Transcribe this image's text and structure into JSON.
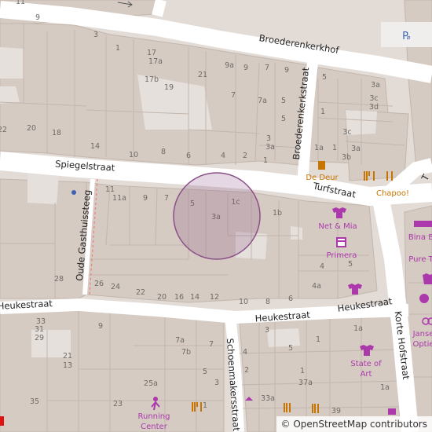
{
  "map": {
    "streets": {
      "broederenkerkhof": "Broederenkerkhof",
      "broederenkerkstraat": "Broederenkerkstraat",
      "spiegelstraat": "Spiegelstraat",
      "turfstraat": "Turfstraat",
      "oude_gasthuissteeg": "Oude Gasthuissteeg",
      "heukestraat_left": "Heukestraat",
      "heukestraat_mid": "Heukestraat",
      "heukestraat_right": "Heukestraat",
      "korte_hofstraat": "Korte Hofstraat",
      "schoenmakersstraat": "Schoenmakersstraat",
      "top_right_partial": "T"
    },
    "pois": {
      "de_deur": "De Deur",
      "chapoo": "Chapoo!",
      "net_en_mia": "Net & Mia",
      "primera": "Primera",
      "state_of_art": [
        "State of",
        "Art"
      ],
      "running_center": [
        "Running",
        "Center"
      ],
      "bina": "Bina B",
      "pure": "Pure T",
      "janse": [
        "Janse",
        "Optie"
      ]
    },
    "house_numbers": {
      "n11_top": "11",
      "n9_top": "9",
      "n3_top": "3",
      "n1_top": "1",
      "n17": "17",
      "n17a": "17a",
      "n17b": "17b",
      "n19": "19",
      "n21": "21",
      "n9a": "9a",
      "n9": "9",
      "n7": "7",
      "n9b": "9",
      "n7a": "7a",
      "n7b": "7",
      "n5a": "5",
      "n3c": "3",
      "n1c": "1",
      "n22": "22",
      "n20": "20",
      "n18": "18",
      "n14": "14",
      "n10": "10",
      "n8": "8",
      "n6": "6",
      "n4": "4",
      "n2": "2",
      "n3a_b": "3a",
      "n1_b": "1",
      "n5_r": "5",
      "n3a_r": "3a",
      "n3c_r": "3c",
      "n3d_r": "3d",
      "n1a_r": "1a",
      "n1_r": "1",
      "n3c2_r": "3c",
      "n3_r": "3",
      "n3a2_r": "3a",
      "n3b_r": "3b",
      "n11_m": "11",
      "n11a": "11a",
      "n9_m": "9",
      "n7_m": "7",
      "n5_m": "5",
      "n3a_m": "3a",
      "n1c_m": "1c",
      "n1b_m": "1b",
      "n28": "28",
      "n26": "26",
      "n24": "24",
      "n22_m": "22",
      "n20_m": "20",
      "n16": "16",
      "n14_m": "14",
      "n12": "12",
      "n10_m": "10",
      "n8_m": "8",
      "n6_m": "6",
      "n4_m": "4",
      "n5_mm": "5",
      "n4a": "4a",
      "n33": "33",
      "n31": "31",
      "n29": "29",
      "n13": "13",
      "n9_b": "9",
      "n35": "35",
      "n23": "23",
      "n7a_b": "7a",
      "n7b_b": "7b",
      "n7_b": "7",
      "n5_b": "5",
      "n3_b": "3",
      "n1_bb": "1",
      "n25a": "25a",
      "n4_bb": "4",
      "n2_bb": "2",
      "n3_bb": "3",
      "n1_b3": "1",
      "n1a_b": "1a",
      "n5_b2": "5",
      "n1_b4": "1",
      "n37a": "37a",
      "n33a": "33a",
      "n39": "39",
      "n1a_b2": "1a"
    },
    "parking_label": "P",
    "circle_color": "#8a4f86",
    "colors": {
      "road": "#ffffff",
      "building": "#d3c9c1",
      "building_stroke": "#c4b8af",
      "ground": "#e7e2de"
    },
    "attribution": "© OpenStreetMap contributors"
  }
}
